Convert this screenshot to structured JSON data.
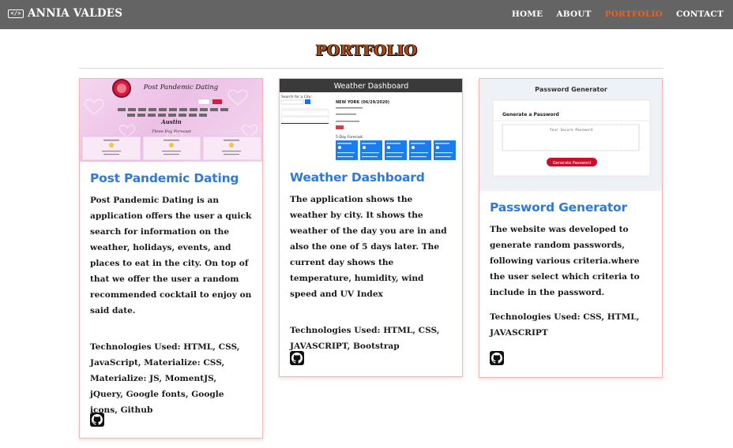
{
  "nav": {
    "brand": "ANNIA VALDES",
    "brand_icon": "code-icon",
    "links": [
      "HOME",
      "ABOUT",
      "PORTFOLIO",
      "CONTACT"
    ],
    "active_link": "PORTFOLIO",
    "active_color": "#e0652a"
  },
  "page": {
    "title": "PORTFOLIO"
  },
  "cards": [
    {
      "title": "Post Pandemic Dating",
      "description": "Post Pandemic Dating is an application offers the user a quick search for information on the weather, holidays, events, and places to eat in the city. On top of that we offer the user a random recommended cocktail to enjoy on said date.",
      "technologies": "Technologies Used: HTML, CSS, JavaScript, Materialize: CSS, Materialize: JS, MomentJS, jQuery, Google fonts, Google icons, Github",
      "link_icon": "github-icon",
      "thumb": {
        "heading": "Post Pandemic Dating",
        "city": "Austin",
        "subheading": "Three Day Forecast"
      }
    },
    {
      "title": "Weather Dashboard",
      "description": "The application shows the weather by city. It shows the weather of the day you are in and also the one of 5 days later. The current day shows the temperature, humidity, wind speed and UV Index",
      "technologies": "Technologies Used: HTML, CSS, JAVASCRIPT, Bootstrap",
      "link_icon": "github-icon",
      "thumb": {
        "header": "Weather Dashboard",
        "search_label": "Search for a City:",
        "city_line": "NEW YORK (06/29/2020)",
        "forecast_label": "5-Day Forecast:"
      }
    },
    {
      "title": "Password Generator",
      "description": "The website was developed to generate random passwords, following various criteria.where the user select which criteria to include in the password.",
      "technologies": "Technologies Used: CSS, HTML, JAVASCRIPT",
      "link_icon": "github-icon",
      "thumb": {
        "header": "Password Generator",
        "card_title": "Generate a Password",
        "placeholder": "Your Secure Password",
        "button": "Generate Password"
      }
    }
  ]
}
